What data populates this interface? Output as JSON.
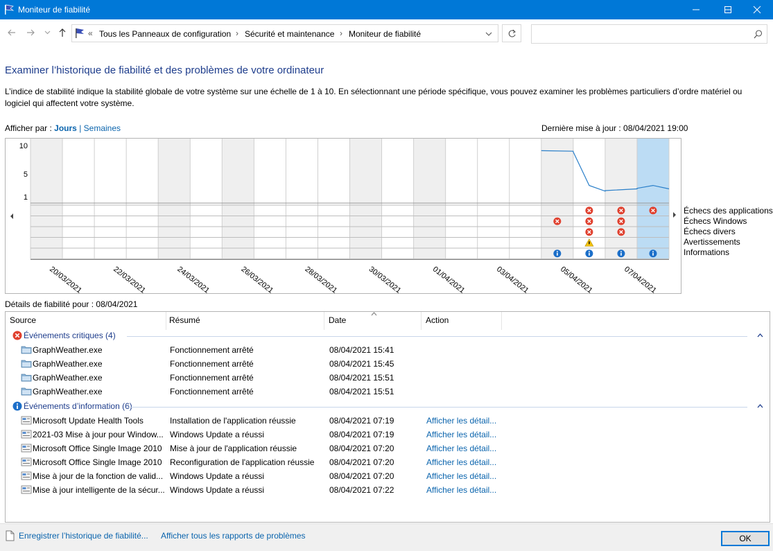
{
  "window": {
    "title": "Moniteur de fiabilité"
  },
  "address": {
    "overflow": "«",
    "crumbs": [
      "Tous les Panneaux de configuration",
      "Sécurité et maintenance",
      "Moniteur de fiabilité"
    ],
    "search_placeholder": ""
  },
  "heading": "Examiner l’historique de fiabilité et des problèmes de votre ordinateur",
  "intro": "L’indice de stabilité indique la stabilité globale de votre système sur une échelle de 1 à 10. En sélectionnant une période spécifique, vous pouvez examiner les problèmes particuliers d’ordre matériel ou logiciel qui affectent votre système.",
  "view_by": {
    "label": "Afficher par :",
    "days": "Jours",
    "separator": "|",
    "weeks": "Semaines"
  },
  "last_update": "Dernière mise à jour : 08/04/2021 19:00",
  "details_for": "Détails de fiabilité pour : 08/04/2021",
  "chart_data": {
    "type": "line",
    "y_ticks": [
      "10",
      "5",
      "1"
    ],
    "ylim": [
      1,
      10
    ],
    "columns": 20,
    "date_labels": [
      "20/03/2021",
      "22/03/2021",
      "24/03/2021",
      "26/03/2021",
      "28/03/2021",
      "30/03/2021",
      "01/04/2021",
      "03/04/2021",
      "05/04/2021",
      "07/04/2021"
    ],
    "stability_index": [
      {
        "col": 16,
        "values": [
          9.1,
          9.0
        ]
      },
      {
        "col": 17,
        "values": [
          8.9,
          3.0,
          2.0
        ]
      },
      {
        "col": 18,
        "values": [
          2.1,
          2.4
        ]
      },
      {
        "col": 19,
        "values": [
          2.5,
          3.0,
          2.4
        ]
      }
    ],
    "legend": [
      "Échecs des applications",
      "Échecs Windows",
      "Échecs divers",
      "Avertissements",
      "Informations"
    ],
    "events": [
      {
        "col": 16,
        "row": 1,
        "kind": "error"
      },
      {
        "col": 17,
        "row": 0,
        "kind": "error"
      },
      {
        "col": 17,
        "row": 1,
        "kind": "error"
      },
      {
        "col": 17,
        "row": 2,
        "kind": "error"
      },
      {
        "col": 17,
        "row": 3,
        "kind": "warning"
      },
      {
        "col": 18,
        "row": 0,
        "kind": "error"
      },
      {
        "col": 18,
        "row": 1,
        "kind": "error"
      },
      {
        "col": 18,
        "row": 2,
        "kind": "error"
      },
      {
        "col": 19,
        "row": 0,
        "kind": "error"
      },
      {
        "col": 16,
        "row": 4,
        "kind": "info"
      },
      {
        "col": 17,
        "row": 4,
        "kind": "info"
      },
      {
        "col": 18,
        "row": 4,
        "kind": "info"
      },
      {
        "col": 19,
        "row": 4,
        "kind": "info"
      }
    ],
    "selected_col": 19,
    "shaded_cols": [
      0,
      4,
      6,
      10,
      12,
      16,
      18
    ]
  },
  "table": {
    "columns": [
      "Source",
      "Résumé",
      "Date",
      "Action"
    ],
    "critical_group": "Événements critiques (4)",
    "critical_rows": [
      {
        "source": "GraphWeather.exe",
        "summary": "Fonctionnement arrêté",
        "date": "08/04/2021 15:41",
        "action": ""
      },
      {
        "source": "GraphWeather.exe",
        "summary": "Fonctionnement arrêté",
        "date": "08/04/2021 15:45",
        "action": ""
      },
      {
        "source": "GraphWeather.exe",
        "summary": "Fonctionnement arrêté",
        "date": "08/04/2021 15:51",
        "action": ""
      },
      {
        "source": "GraphWeather.exe",
        "summary": "Fonctionnement arrêté",
        "date": "08/04/2021 15:51",
        "action": ""
      }
    ],
    "info_group": "Événements d’information (6)",
    "info_rows": [
      {
        "source": "Microsoft Update Health Tools",
        "summary": "Installation de l'application réussie",
        "date": "08/04/2021 07:19",
        "action": "Afficher les détail..."
      },
      {
        "source": "2021-03 Mise à jour pour Window...",
        "summary": "Windows Update a réussi",
        "date": "08/04/2021 07:19",
        "action": "Afficher les détail..."
      },
      {
        "source": "Microsoft Office Single Image 2010",
        "summary": "Mise à jour de l'application réussie",
        "date": "08/04/2021 07:20",
        "action": "Afficher les détail..."
      },
      {
        "source": "Microsoft Office Single Image 2010",
        "summary": "Reconfiguration de l'application réussie",
        "date": "08/04/2021 07:20",
        "action": "Afficher les détail..."
      },
      {
        "source": "Mise à jour de la fonction de valid...",
        "summary": "Windows Update a réussi",
        "date": "08/04/2021 07:20",
        "action": "Afficher les détail..."
      },
      {
        "source": "Mise à jour intelligente de la sécur...",
        "summary": "Windows Update a réussi",
        "date": "08/04/2021 07:22",
        "action": "Afficher les détail..."
      }
    ]
  },
  "footer": {
    "save_history": "Enregistrer l’historique de fiabilité...",
    "all_reports": "Afficher tous les rapports de problèmes",
    "ok": "OK"
  },
  "colors": {
    "titlebar": "#0078d7",
    "link": "#0a64ad",
    "heading": "#1e3d8c",
    "selected": "#bcdcf4",
    "shaded": "#efefef",
    "line": "#2a7fc9",
    "error": "#e0402e",
    "info": "#1c6fc9",
    "warning": "#f2c20f"
  }
}
